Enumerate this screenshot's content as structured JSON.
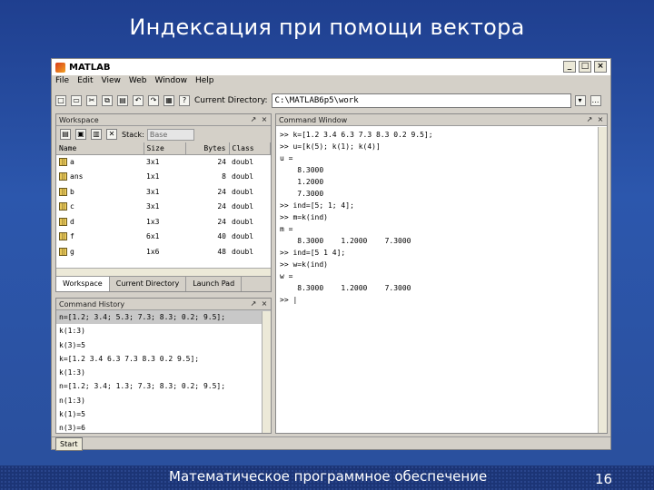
{
  "slide": {
    "title": "Индексация при помощи вектора",
    "footer": "Математическое программное обеспечение",
    "page_number": "16"
  },
  "window": {
    "app_title": "MATLAB",
    "controls": [
      "_",
      "□",
      "×"
    ],
    "menu": [
      "File",
      "Edit",
      "View",
      "Web",
      "Window",
      "Help"
    ],
    "current_directory_label": "Current Directory:",
    "current_directory_value": "C:\\MATLAB6p5\\work"
  },
  "workspace": {
    "title": "Workspace",
    "stack_label": "Stack:",
    "stack_value": "Base",
    "columns": [
      "Name",
      "Size",
      "Bytes",
      "Class"
    ],
    "rows": [
      {
        "name": "a",
        "size": "3x1",
        "bytes": "24",
        "class": "doubl"
      },
      {
        "name": "ans",
        "size": "1x1",
        "bytes": "8",
        "class": "doubl"
      },
      {
        "name": "b",
        "size": "3x1",
        "bytes": "24",
        "class": "doubl"
      },
      {
        "name": "c",
        "size": "3x1",
        "bytes": "24",
        "class": "doubl"
      },
      {
        "name": "d",
        "size": "1x3",
        "bytes": "24",
        "class": "doubl"
      },
      {
        "name": "f",
        "size": "6x1",
        "bytes": "40",
        "class": "doubl"
      },
      {
        "name": "g",
        "size": "1x6",
        "bytes": "48",
        "class": "doubl"
      }
    ],
    "tabs": [
      "Workspace",
      "Current Directory",
      "Launch Pad"
    ]
  },
  "history": {
    "title": "Command History",
    "lines": [
      "n=[1.2; 3.4; 5.3; 7.3; 8.3; 0.2; 9.5];",
      "k(1:3)",
      "k(3)=5",
      "k=[1.2 3.4 6.3 7.3 8.3 0.2 9.5];",
      "k(1:3)",
      "n=[1.2; 3.4; 1.3; 7.3; 8.3; 0.2; 9.5];",
      "n(1:3)",
      "k(1)=5",
      "n(3)=6"
    ]
  },
  "command": {
    "title": "Command Window",
    "lines": [
      ">> k=[1.2 3.4 6.3 7.3 8.3 0.2 9.5];",
      ">> u=[k(5); k(1); k(4)]",
      "",
      "u =",
      "",
      "    8.3000",
      "    1.2000",
      "    7.3000",
      "",
      ">> ind=[5; 1; 4];",
      ">> m=k(ind)",
      "",
      "m =",
      "",
      "    8.3000    1.2000    7.3000",
      "",
      ">> ind=[5 1 4];",
      ">> w=k(ind)",
      "",
      "w =",
      "",
      "    8.3000    1.2000    7.3000",
      "",
      ">> |"
    ]
  },
  "startbar": {
    "label": "Start"
  }
}
